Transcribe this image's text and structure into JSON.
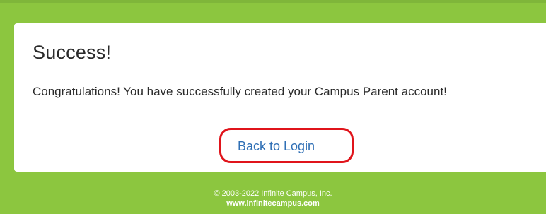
{
  "card": {
    "title": "Success!",
    "message": "Congratulations! You have successfully created your Campus Parent account!",
    "link_label": "Back to Login"
  },
  "footer": {
    "copyright": "© 2003-2022 Infinite Campus, Inc.",
    "website": "www.infinitecampus.com"
  },
  "colors": {
    "background": "#8cc63f",
    "card": "#ffffff",
    "link": "#2f6fb5",
    "annotation": "#e0141b"
  }
}
